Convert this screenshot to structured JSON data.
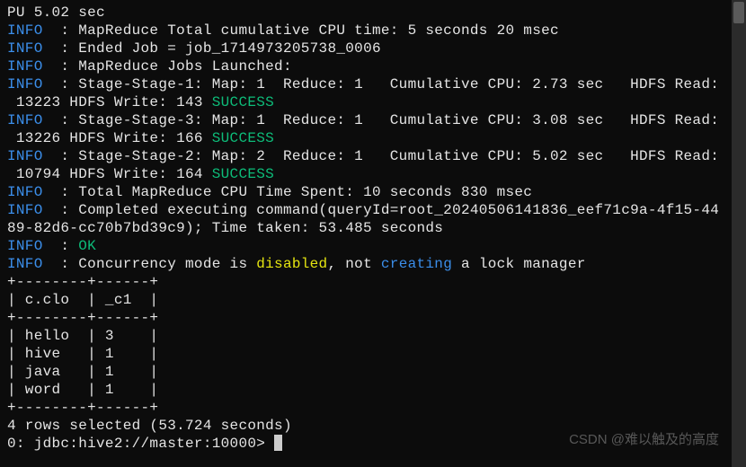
{
  "lines": {
    "l0": "PU 5.02 sec",
    "info": "INFO",
    "l1": "  : MapReduce Total cumulative CPU time: 5 seconds 20 msec",
    "l2": "  : Ended Job = job_1714973205738_0006",
    "l3": "  : MapReduce Jobs Launched:",
    "l4a": "  : Stage-Stage-1: Map: 1  Reduce: 1   Cumulative CPU: 2.73 sec   HDFS Read:",
    "l4b": " 13223 HDFS Write: 143 ",
    "success": "SUCCESS",
    "l5a": "  : Stage-Stage-3: Map: 1  Reduce: 1   Cumulative CPU: 3.08 sec   HDFS Read:",
    "l5b": " 13226 HDFS Write: 166 ",
    "l6a": "  : Stage-Stage-2: Map: 2  Reduce: 1   Cumulative CPU: 5.02 sec   HDFS Read:",
    "l6b": " 10794 HDFS Write: 164 ",
    "l7": "  : Total MapReduce CPU Time Spent: 10 seconds 830 msec",
    "l8a": "  : Completed executing command(queryId=root_20240506141836_eef71c9a-4f15-44",
    "l8b": "89-82d6-cc70b7bd39c9); Time taken: 53.485 seconds",
    "l9": "  : ",
    "ok": "OK",
    "l10a": "  : Concurrency mode is ",
    "disabled": "disabled",
    "l10b": ", not ",
    "creating": "creating",
    "l10c": " a lock manager",
    "tborder": "+--------+------+",
    "thead": "| c.clo  | _c1  |",
    "r1": "| hello  | 3    |",
    "r2": "| hive   | 1    |",
    "r3": "| java   | 1    |",
    "r4": "| word   | 1    |",
    "summary": "4 rows selected (53.724 seconds)",
    "prompt": "0: jdbc:hive2://master:10000> "
  },
  "watermark": "CSDN @难以触及的高度",
  "table_data": {
    "columns": [
      "c.clo",
      "_c1"
    ],
    "rows": [
      {
        "c.clo": "hello",
        "_c1": 3
      },
      {
        "c.clo": "hive",
        "_c1": 1
      },
      {
        "c.clo": "java",
        "_c1": 1
      },
      {
        "c.clo": "word",
        "_c1": 1
      }
    ]
  }
}
